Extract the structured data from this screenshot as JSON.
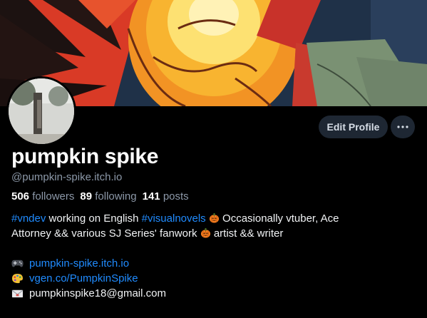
{
  "colors": {
    "background": "#000000",
    "accent_link": "#208bfe",
    "muted_text": "#8c98a8",
    "button_bg": "#1e2733"
  },
  "profile": {
    "display_name": "pumpkin spike",
    "handle": "@pumpkin-spike.itch.io",
    "edit_profile_label": "Edit Profile",
    "more_icon": "ellipsis-icon"
  },
  "stats": {
    "followers_count": "506",
    "followers_label": "followers",
    "following_count": "89",
    "following_label": "following",
    "posts_count": "141",
    "posts_label": "posts"
  },
  "bio": {
    "tag_1": "#vndev",
    "text_1": " working on English ",
    "tag_2": "#visualnovels",
    "text_2": " Occasionally vtuber, Ace",
    "line_2a": "Attorney && various SJ Series' fanwork",
    "line_2b": " artist && writer",
    "links": [
      {
        "icon": "gamepad-icon",
        "text": "pumpkin-spike.itch.io"
      },
      {
        "icon": "palette-icon",
        "text": "vgen.co/PumpkinSpike"
      },
      {
        "icon": "envelope-icon",
        "text": "pumpkinspike18@gmail.com"
      }
    ]
  }
}
